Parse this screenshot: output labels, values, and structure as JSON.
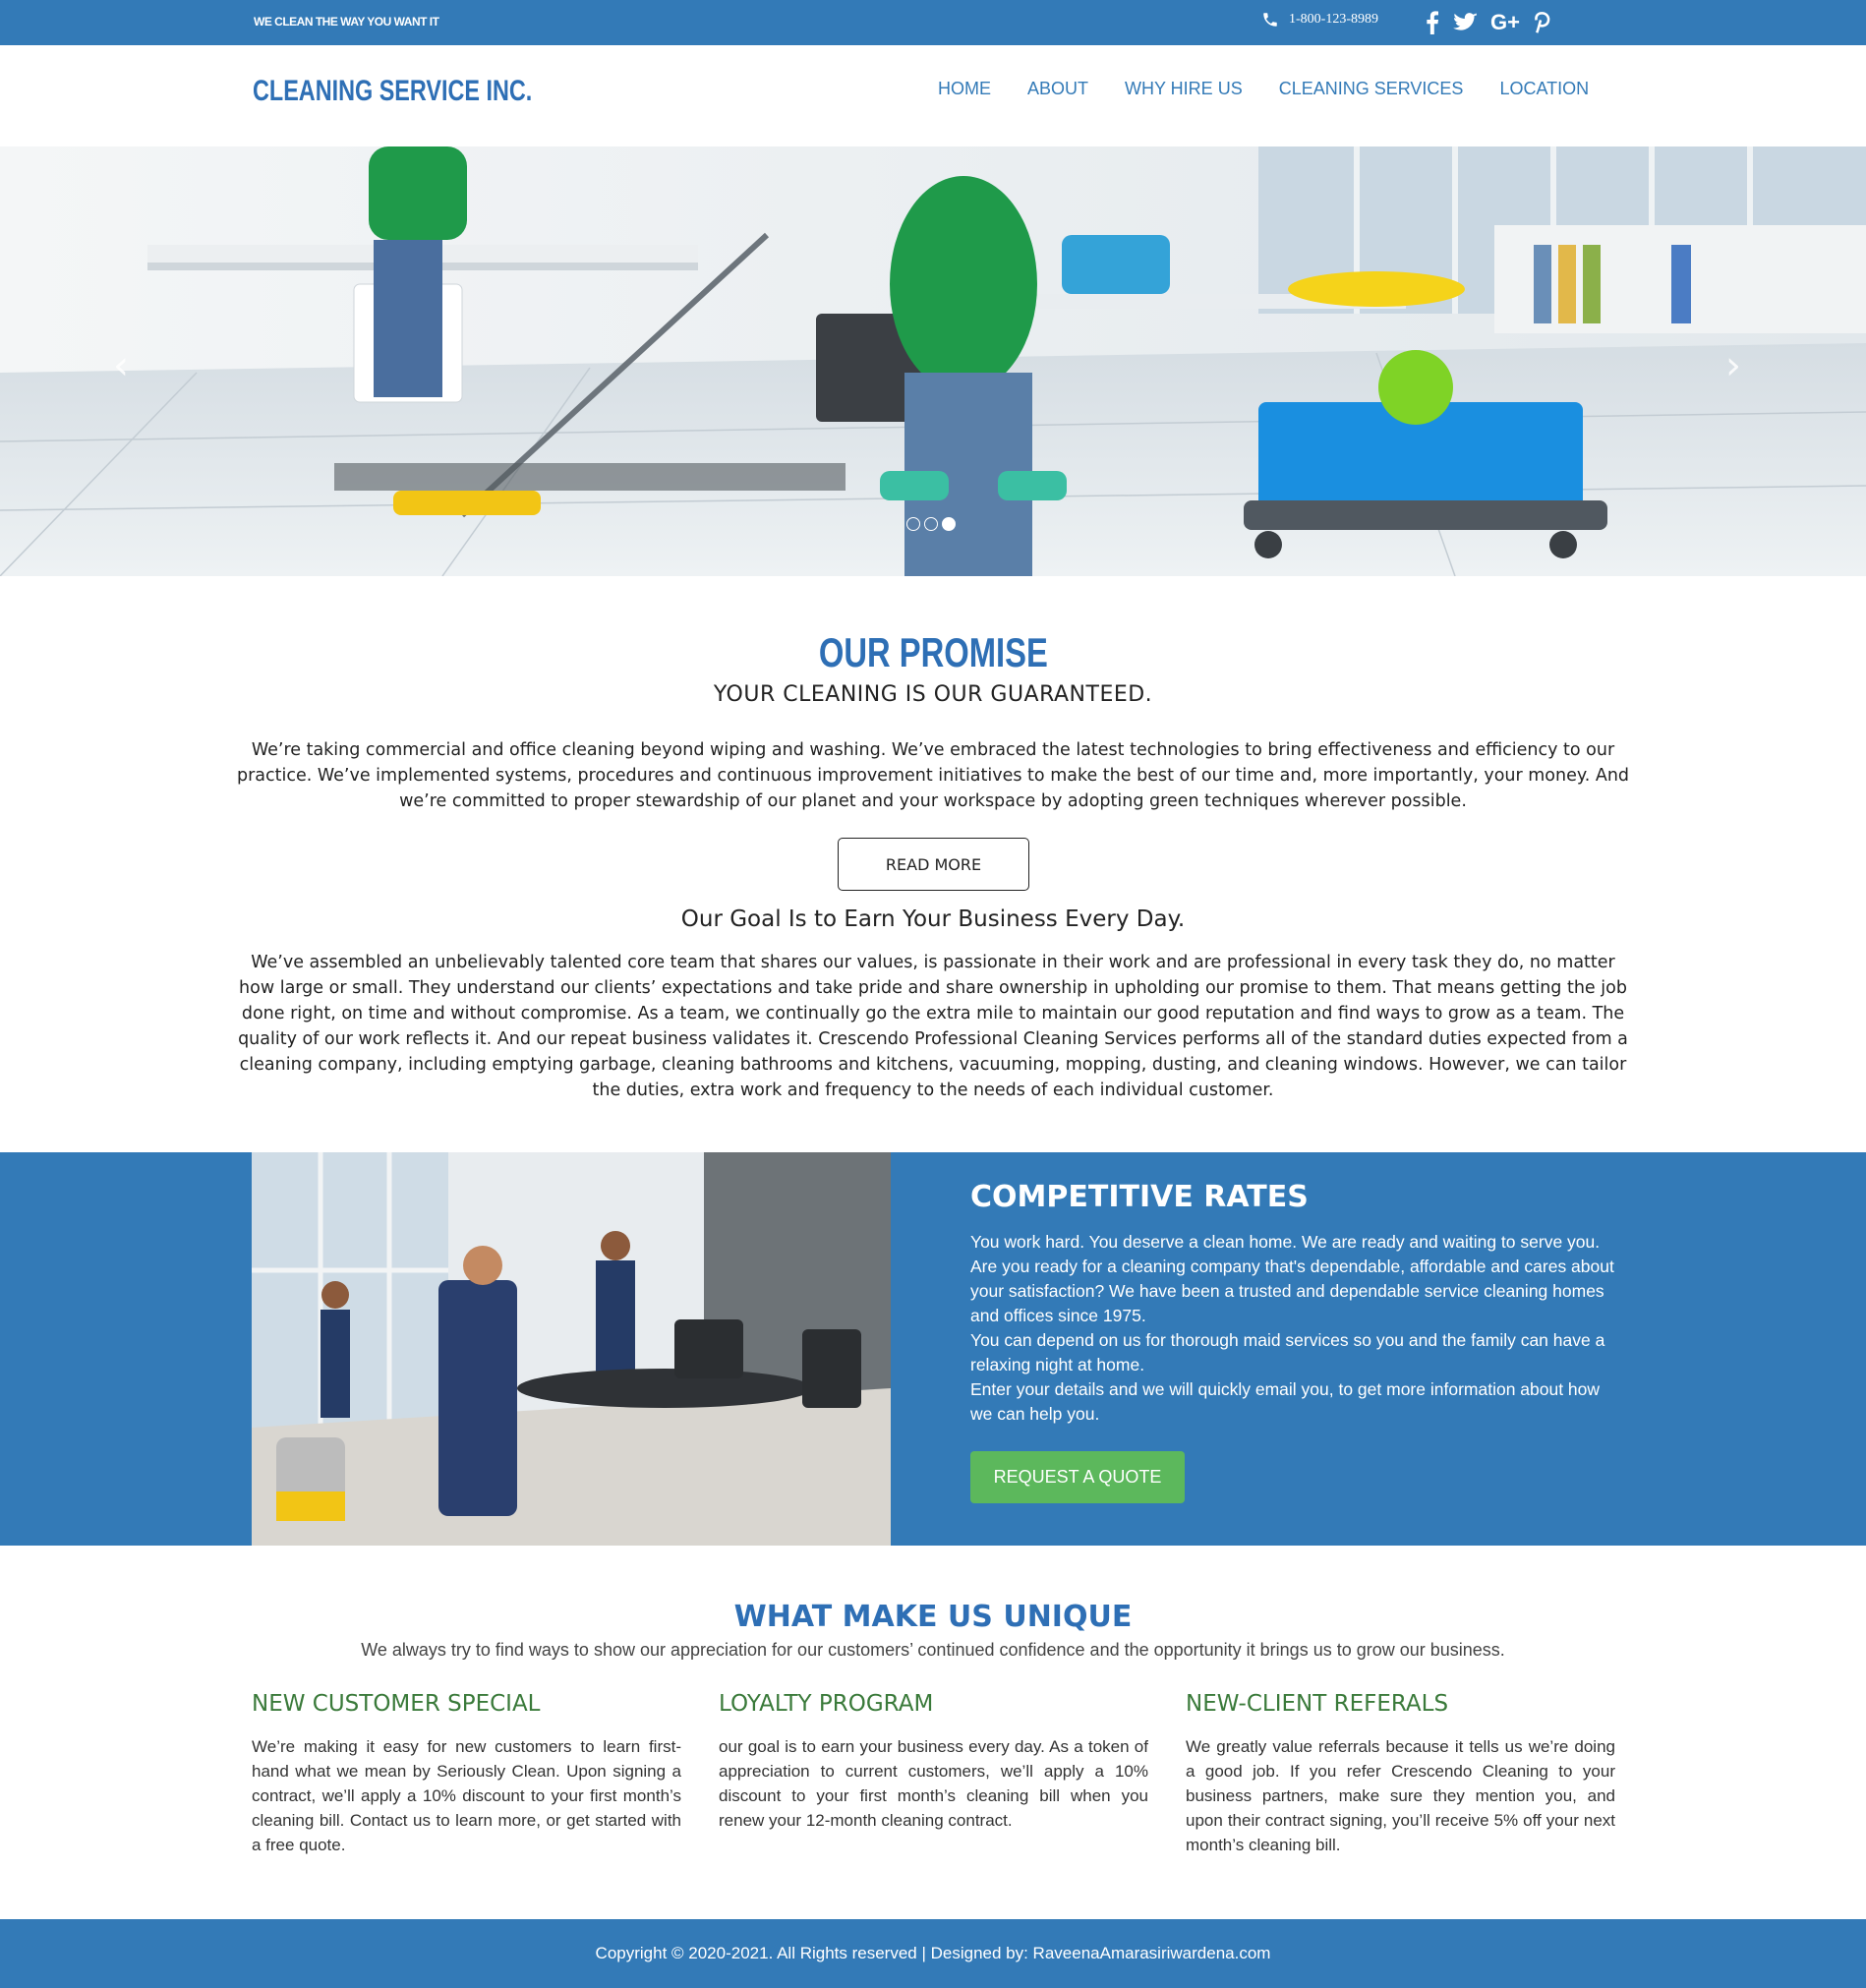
{
  "topbar": {
    "tagline": "WE CLEAN THE WAY YOU WANT IT",
    "phone": "1-800-123-8989",
    "social": [
      "facebook-icon",
      "twitter-icon",
      "google-plus-icon",
      "pinterest-icon"
    ],
    "social_labels": {
      "google_plus": "G+"
    }
  },
  "header": {
    "logo": "CLEANING SERVICE INC.",
    "nav": [
      "HOME",
      "ABOUT",
      "WHY HIRE US",
      "CLEANING SERVICES",
      "LOCATION"
    ]
  },
  "hero": {
    "prev_arrow": "‹",
    "next_arrow": "›",
    "slides": 3,
    "active_slide": 3
  },
  "promise": {
    "title": "OUR PROMISE",
    "subtitle": "YOUR CLEANING IS OUR GUARANTEED.",
    "paragraph": "We’re taking commercial and office cleaning beyond wiping and washing. We’ve embraced the latest technologies to bring effectiveness and efficiency to our practice. We’ve implemented systems, procedures and continuous improvement initiatives to make the best of our time and, more importantly, your money. And we’re committed to proper stewardship of our planet and your workspace by adopting green techniques wherever possible.",
    "read_more": "READ MORE",
    "goal_heading": "Our Goal Is to Earn Your Business Every Day.",
    "goal_paragraph": "We’ve assembled an unbelievably talented core team that shares our values, is passionate in their work and are professional in every task they do, no matter how large or small. They understand our clients’ expectations and take pride and share ownership in upholding our promise to them. That means getting the job done right, on time and without compromise. As a team, we continually go the extra mile to maintain our good reputation and find ways to grow as a team. The quality of our work reflects it. And our repeat business validates it. Crescendo Professional Cleaning Services performs all of the standard duties expected from a cleaning company, including emptying garbage, cleaning bathrooms and kitchens, vacuuming, mopping, dusting, and cleaning windows. However, we can tailor the duties, extra work and frequency to the needs of each individual customer."
  },
  "rates": {
    "title": "COMPETITIVE RATES",
    "lines": [
      "You work hard. You deserve a clean home. We are ready and waiting to serve you.",
      "Are you ready for a cleaning company that's dependable, affordable and cares about your satisfaction? We have been a trusted and dependable service cleaning homes and offices since 1975.",
      "You can depend on us for thorough maid services so you and the family can have a relaxing night at home.",
      "Enter your details and we will quickly email you, to get more information about how we can help you."
    ],
    "button": "REQUEST A QUOTE"
  },
  "unique": {
    "title": "WHAT MAKE US UNIQUE",
    "subtitle": "We always try to find ways to show our appreciation for our customers’ continued confidence and the opportunity it brings us to grow our business.",
    "columns": [
      {
        "heading": "NEW CUSTOMER SPECIAL",
        "text": "We’re making it easy for new customers to learn first-hand what we mean by Seriously Clean. Upon signing a contract, we’ll apply a 10% discount to your first month’s cleaning bill. Contact us to learn more, or get started with a free quote."
      },
      {
        "heading": "LOYALTY PROGRAM",
        "text": "our goal is to earn your business every day. As a token of appreciation to current customers, we’ll apply a 10% discount to your first month’s cleaning bill when you renew your 12-month cleaning contract."
      },
      {
        "heading": "NEW-CLIENT REFERALS",
        "text": "We greatly value referrals because it tells us we’re doing a good job. If you refer Crescendo Cleaning to your business partners, make sure they mention you, and upon their contract signing, you’ll receive 5% off your next month’s cleaning bill."
      }
    ]
  },
  "footer": {
    "copyright": "Copyright © 2020-2021. All Rights reserved | Designed by: RaveenaAmarasiriwardena.com"
  },
  "colors": {
    "brand_blue": "#337ab7",
    "heading_blue": "#2e6fb5",
    "button_green": "#5cb85c",
    "column_heading_green": "#3a7a3a"
  }
}
